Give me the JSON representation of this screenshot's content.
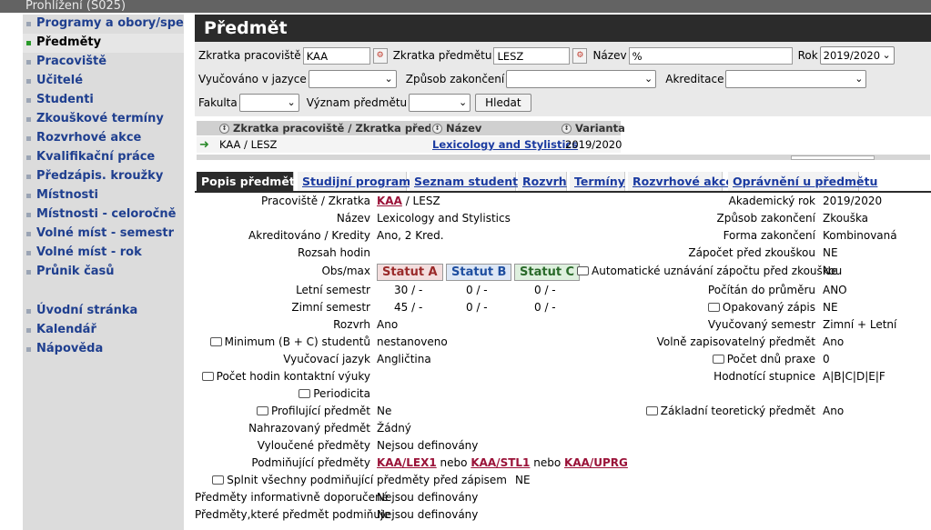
{
  "window": {
    "title": "Prohlížení (S025)"
  },
  "sidebar": {
    "items": [
      {
        "label": "Programy a obory/spec.",
        "active": false
      },
      {
        "label": "Předměty",
        "active": true
      },
      {
        "label": "Pracoviště",
        "active": false
      },
      {
        "label": "Učitelé",
        "active": false
      },
      {
        "label": "Studenti",
        "active": false
      },
      {
        "label": "Zkouškové termíny",
        "active": false
      },
      {
        "label": "Rozvrhové akce",
        "active": false
      },
      {
        "label": "Kvalifikační práce",
        "active": false
      },
      {
        "label": "Předzápis. kroužky",
        "active": false
      },
      {
        "label": "Místnosti",
        "active": false
      },
      {
        "label": "Místnosti - celoročně",
        "active": false
      },
      {
        "label": "Volné míst - semestr",
        "active": false
      },
      {
        "label": "Volné míst - rok",
        "active": false
      },
      {
        "label": "Průnik časů",
        "active": false
      }
    ],
    "bottom_items": [
      {
        "label": "Úvodní stránka"
      },
      {
        "label": "Kalendář"
      },
      {
        "label": "Nápověda"
      }
    ]
  },
  "page": {
    "title": "Předmět"
  },
  "filters": {
    "zkratka_pracoviste": {
      "label": "Zkratka pracoviště",
      "value": "KAA"
    },
    "zkratka_predmetu": {
      "label": "Zkratka předmětu",
      "value": "LESZ"
    },
    "nazev": {
      "label": "Název",
      "value": "%"
    },
    "rok": {
      "label": "Rok",
      "value": "2019/2020"
    },
    "vyucovano_v_jazyce": {
      "label": "Vyučováno v jazyce",
      "value": ""
    },
    "zpusob_zakonceni": {
      "label": "Způsob zakončení",
      "value": ""
    },
    "akreditace": {
      "label": "Akreditace",
      "value": ""
    },
    "fakulta": {
      "label": "Fakulta",
      "value": ""
    },
    "vyznam_predmetu": {
      "label": "Význam předmětu",
      "value": ""
    },
    "search_button": "Hledat"
  },
  "results": {
    "headers": [
      "Zkratka pracoviště / Zkratka předmětu",
      "Název",
      "Varianta"
    ],
    "rows": [
      {
        "code": "KAA / LESZ",
        "name": "Lexicology and Stylistics",
        "variant": "2019/2020"
      }
    ]
  },
  "tabs": [
    {
      "label": "Popis předmětu",
      "active": true
    },
    {
      "label": "Studijní programy",
      "active": false
    },
    {
      "label": "Seznam studentů",
      "active": false
    },
    {
      "label": "Rozvrh",
      "active": false
    },
    {
      "label": "Termíny",
      "active": false
    },
    {
      "label": "Rozvrhové akce",
      "active": false
    },
    {
      "label": "Oprávnění u předmětu",
      "active": false
    }
  ],
  "detail": {
    "pracoviste_zkratka": {
      "label": "Pracoviště / Zkratka",
      "link": "KAA",
      "rest": "/ LESZ"
    },
    "nazev": {
      "label": "Název",
      "value": "Lexicology and Stylistics"
    },
    "akreditovano": {
      "label": "Akreditováno / Kredity",
      "value": "Ano, 2 Kred."
    },
    "rozsah_hodin": {
      "label": "Rozsah hodin",
      "value": ""
    },
    "obs_max": {
      "label": "Obs/max",
      "statut_a": "Statut A",
      "statut_b": "Statut B",
      "statut_c": "Statut C"
    },
    "letni_semestr": {
      "label": "Letní semestr",
      "a": "30 / -",
      "b": "0 / -",
      "c": "0 / -"
    },
    "zimni_semestr": {
      "label": "Zimní semestr",
      "a": "45 / -",
      "b": "0 / -",
      "c": "0 / -"
    },
    "rozvrh": {
      "label": "Rozvrh",
      "value": "Ano"
    },
    "minimum_studentu": {
      "label": "Minimum (B + C) studentů",
      "value": "nestanoveno"
    },
    "vyucovaci_jazyk": {
      "label": "Vyučovací jazyk",
      "value": "Angličtina"
    },
    "pocet_hodin_kontakt": {
      "label": "Počet hodin kontaktní výuky",
      "value": ""
    },
    "periodicita": {
      "label": "Periodicita",
      "value": ""
    },
    "profilujici": {
      "label": "Profilující předmět",
      "value": "Ne"
    },
    "nahrazovany": {
      "label": "Nahrazovaný předmět",
      "value": "Žádný"
    },
    "vyloucene": {
      "label": "Vyloučené předměty",
      "value": "Nejsou definovány"
    },
    "podminujici": {
      "label": "Podmiňující předměty",
      "link1": "KAA/LEX1",
      "sep1": "nebo",
      "link2": "KAA/STL1",
      "sep2": "nebo",
      "link3": "KAA/UPRG"
    },
    "splnit_vsechny": {
      "label": "Splnit všechny podmiňující předměty před zápisem",
      "value": "NE"
    },
    "informativne_doporucene": {
      "label": "Předměty informativně doporučené",
      "value": "Nejsou definovány"
    },
    "ktere_podminuje": {
      "label": "Předměty,které předmět podmiňuje",
      "value": "Nejsou definovány"
    },
    "akademicky_rok": {
      "label": "Akademický rok",
      "value": "2019/2020"
    },
    "zpusob_zakonceni": {
      "label": "Způsob zakončení",
      "value": "Zkouška"
    },
    "forma_zakonceni": {
      "label": "Forma zakončení",
      "value": "Kombinovaná"
    },
    "zapocet_pred_zkouskou": {
      "label": "Zápočet před zkouškou",
      "value": "NE"
    },
    "automaticke_uznani": {
      "label": "Automatické uznávání zápočtu před zkouškou",
      "value": "Ne"
    },
    "pocitan_do_prumeru": {
      "label": "Počítán do průměru",
      "value": "ANO"
    },
    "opakovany_zapis": {
      "label": "Opakovaný zápis",
      "value": "NE"
    },
    "vyucovany_semestr": {
      "label": "Vyučovaný semestr",
      "value": "Zimní + Letní"
    },
    "volne_zapisovatelny": {
      "label": "Volně zapisovatelný předmět",
      "value": "Ano"
    },
    "pocet_dnu_praxe": {
      "label": "Počet dnů praxe",
      "value": "0"
    },
    "hodnotici_stupnice": {
      "label": "Hodnotící stupnice",
      "value": "A|B|C|D|E|F"
    },
    "zakladni_teoreticky": {
      "label": "Základní teoretický předmět",
      "value": "Ano"
    }
  },
  "colors": {
    "title_bar": "#2b2b2b",
    "link": "#1a3aa0",
    "course_link": "#9a1238",
    "sidebar_bg": "#dcdcdc"
  }
}
